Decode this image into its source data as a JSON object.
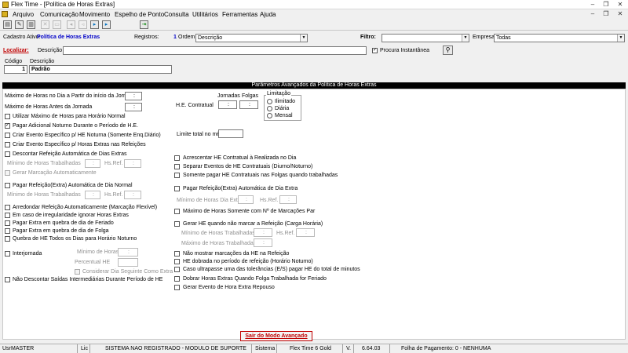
{
  "window": {
    "title": "Flex Time - [Política de Horas Extras]",
    "minimize": "–",
    "restore": "❐",
    "close": "✕"
  },
  "menu": [
    "Arquivo",
    "Comunicação",
    "Movimento",
    "Espelho de Ponto",
    "Consulta",
    "Utilitários",
    "Ferramentas",
    "Ajuda"
  ],
  "toolbar_icons": [
    "new-icon",
    "edit-icon",
    "save-icon",
    "delete-icon",
    "print-icon",
    "first-icon",
    "previous-icon",
    "next-icon",
    "last-icon",
    "exit-icon"
  ],
  "header": {
    "cadastro_label": "Cadastro Ativo:",
    "cadastro_value": "Política de Horas Extras",
    "registros_label": "Registros:",
    "registros_value": "1",
    "ordem_label": "Ordem:",
    "ordem_value": "Descrição",
    "filtro_label": "Filtro:",
    "filtro_value": "",
    "empresa_label": "Empresa",
    "empresa_value": "Todas",
    "localizar_label": "Localizar:",
    "descricao_label": "Descrição",
    "procura_label": "Procura Instantânea"
  },
  "record": {
    "codigo_label": "Código",
    "codigo_value": "1",
    "descricao_label": "Descrição",
    "descricao_value": "Padrão"
  },
  "section_title": "Parâmetros Avançados da Política de Horas Extras",
  "left": {
    "max_inicio": "Máximo de Horas no Dia a Partir do início da Jornada",
    "max_antes": "Máximo de Horas Antes da Jornada",
    "time_sep": ":",
    "chk_utilizar_max": "Utilizar Máximo de Horas para Horário Normal",
    "chk_pagar_adicional": "Pagar Adicional Noturno Durante o Período de H.E.",
    "chk_criar_evento_noturna": "Criar Evento Específico p/ HE Noturna  (Somente Enq.Diário)",
    "chk_criar_evento_refeicoes": "Criar Evento Específico p/ Horas Extras nas Refeições",
    "chk_descontar_refeicao": "Descontar Refeição Automática de Dias Extras",
    "min_horas_trab": "Mínimo de Horas Trabalhadas",
    "hs_ref": "Hs.Ref.",
    "chk_gerar_marcacao": "Gerar Marcação Automaticamente",
    "chk_pagar_refeicao_normal": "Pagar Refeição(Extra) Automática de Dia Normal",
    "chk_arredondar": "Arredondar Refeição Automaticamente (Marcação Flexível)",
    "chk_irregularidade": "Em caso de irregularidade ignorar Horas Extras",
    "chk_quebra_feriado": "Pagar Extra em quebra de dia de Feriado",
    "chk_quebra_folga": "Pagar Extra em quebra de dia de Folga",
    "chk_quebra_noturno": "Quebra de HE Todos os Dias para Horário Noturno",
    "chk_interjornada": "Interjornada",
    "minimo_horas": "Mínimo de Horas",
    "percentual_he": "Percentual HE",
    "chk_considerar_dia": "Considerar Dia Seguinte Como Extra",
    "chk_nao_descontar": "Não Descontar Saídas Intermediárias Durante Período de HE"
  },
  "middle": {
    "he_contratual": "H.E. Contratual",
    "jornadas": "Jornadas",
    "folgas": "Folgas",
    "limitacao": "Limitação",
    "opt_ilimitado": "Ilimitado",
    "opt_diaria": "Diária",
    "opt_mensal": "Mensal",
    "limite_total": "Limite total no mês",
    "chk_acrescentar": "Acrescentar HE Contratual à Realizada no Dia",
    "chk_separar": "Separar Eventos de HE Contratuais (Diurno/Noturno)",
    "chk_somente_folgas": "Somente pagar HE Contratuais nas Folgas quando trabalhadas",
    "chk_pagar_refeicao_extra": "Pagar Refeição(Extra) Automática de Dia Extra",
    "min_horas_dia_extra": "Mínimo de Horas Dia Extra",
    "chk_max_marcacoes": "Máximo de Horas Somente com Nº de Marcações Par",
    "chk_gerar_he_refeicao": "Gerar HE quando não marcar a Refeição (Carga Horária)",
    "max_horas_trab": "Máximo de Horas Trabalhadas",
    "chk_nao_mostrar": "Não mostrar marcações da HE na Refeição",
    "chk_he_dobrada": "HE dobrada no período de refeição (Horário Noturno)",
    "chk_caso_ultrapasse": "Caso ultrapasse uma das tolerâncias (E/S) pagar HE do total de minutos",
    "chk_dobrar_horas": "Dobrar Horas Extras Quando Folga Trabalhada for Feriado",
    "chk_gerar_evento_repouso": "Gerar Evento de Hora Extra Repouso"
  },
  "button_sair": "Sair do Modo Avançado",
  "status": {
    "usr_label": "Usr",
    "usr_value": "MASTER",
    "lic_label": "Lic",
    "lic_value": "SISTEMA NAO REGISTRADO - MODULO DE SUPORTE",
    "sistema_label": "Sistema",
    "sistema_value": "Flex Time 6 Gold",
    "versao_label": "V.",
    "versao_value": "6.64.03",
    "folha": "Folha de Pagamento: 0 - NENHUMA"
  }
}
